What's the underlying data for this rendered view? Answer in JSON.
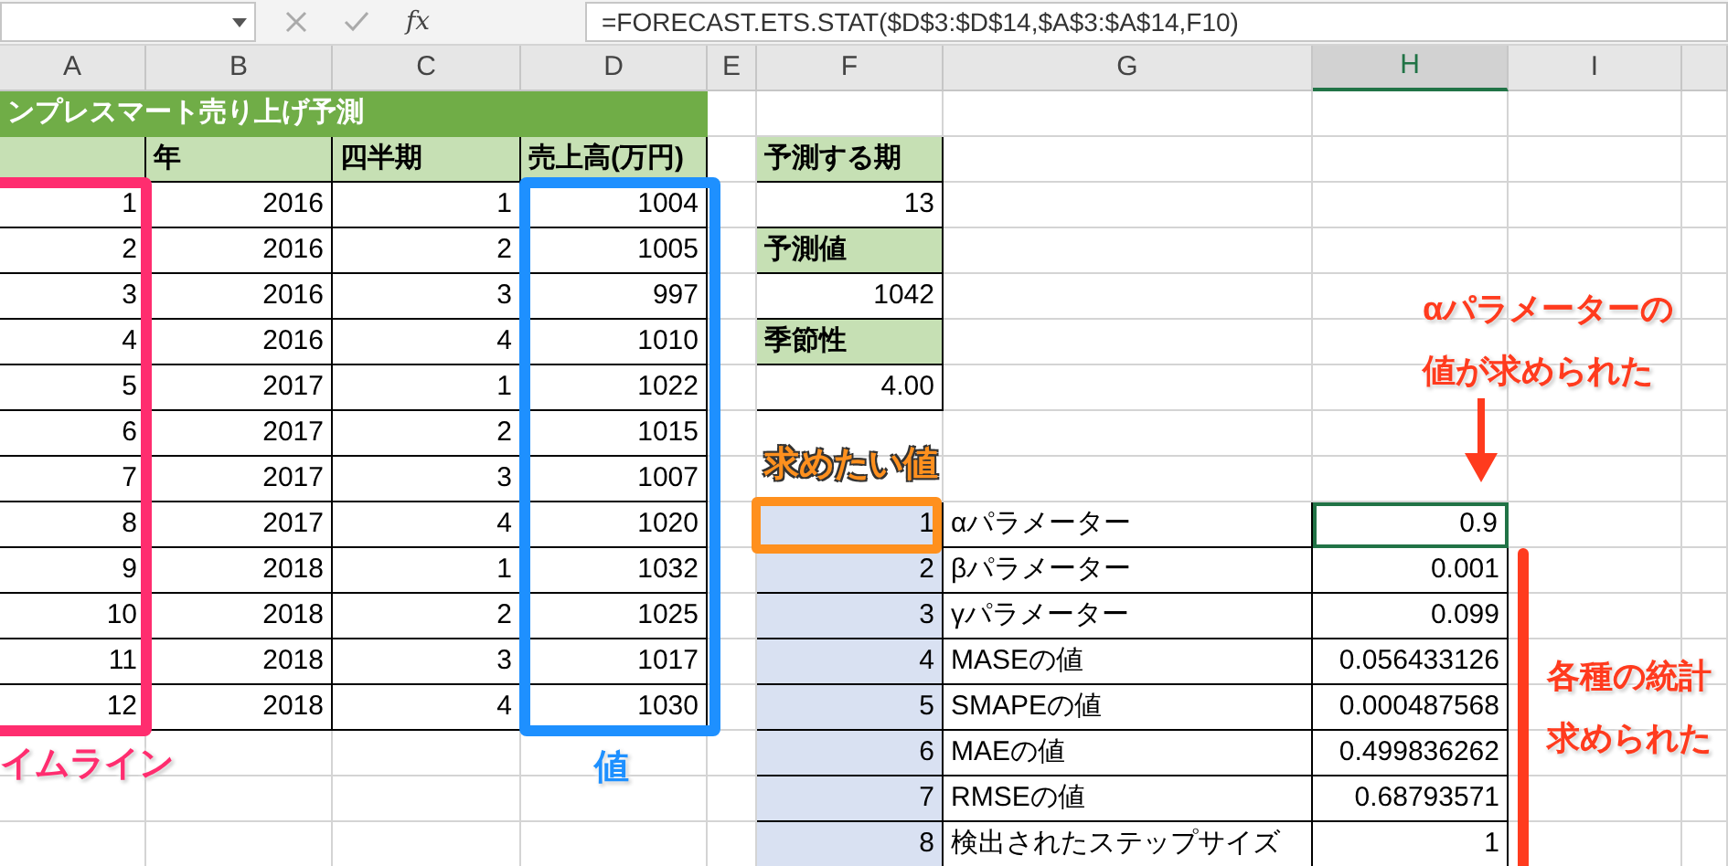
{
  "formula_bar": {
    "fx": "fx",
    "formula": "=FORECAST.ETS.STAT($D$3:$D$14,$A$3:$A$14,F10)"
  },
  "column_headers": [
    {
      "label": "A",
      "selected": false
    },
    {
      "label": "B",
      "selected": false
    },
    {
      "label": "C",
      "selected": false
    },
    {
      "label": "D",
      "selected": false
    },
    {
      "label": "E",
      "selected": false
    },
    {
      "label": "F",
      "selected": false
    },
    {
      "label": "G",
      "selected": false
    },
    {
      "label": "H",
      "selected": true
    },
    {
      "label": "I",
      "selected": false
    }
  ],
  "sheet_title": "ンプレスマート売り上げ予測",
  "sales_table": {
    "columns": [
      "",
      "年",
      "四半期",
      "売上高(万円)"
    ],
    "rows": [
      [
        "1",
        "2016",
        "1",
        "1004"
      ],
      [
        "2",
        "2016",
        "2",
        "1005"
      ],
      [
        "3",
        "2016",
        "3",
        "997"
      ],
      [
        "4",
        "2016",
        "4",
        "1010"
      ],
      [
        "5",
        "2017",
        "1",
        "1022"
      ],
      [
        "6",
        "2017",
        "2",
        "1015"
      ],
      [
        "7",
        "2017",
        "3",
        "1007"
      ],
      [
        "8",
        "2017",
        "4",
        "1020"
      ],
      [
        "9",
        "2018",
        "1",
        "1032"
      ],
      [
        "10",
        "2018",
        "2",
        "1025"
      ],
      [
        "11",
        "2018",
        "3",
        "1017"
      ],
      [
        "12",
        "2018",
        "4",
        "1030"
      ]
    ]
  },
  "forecast_box": [
    {
      "label": "予測する期",
      "value": "13"
    },
    {
      "label": "予測値",
      "value": "1042"
    },
    {
      "label": "季節性",
      "value": "4.00"
    }
  ],
  "stats_table": [
    {
      "index": "1",
      "label": "αパラメーター",
      "value": "0.9",
      "selected": true
    },
    {
      "index": "2",
      "label": "βパラメーター",
      "value": "0.001",
      "selected": false
    },
    {
      "index": "3",
      "label": "γパラメーター",
      "value": "0.099",
      "selected": false
    },
    {
      "index": "4",
      "label": "MASEの値",
      "value": "0.056433126",
      "selected": false
    },
    {
      "index": "5",
      "label": "SMAPEの値",
      "value": "0.000487568",
      "selected": false
    },
    {
      "index": "6",
      "label": "MAEの値",
      "value": "0.499836262",
      "selected": false
    },
    {
      "index": "7",
      "label": "RMSEの値",
      "value": "0.68793571",
      "selected": false
    },
    {
      "index": "8",
      "label": "検出されたステップサイズ",
      "value": "1",
      "selected": false
    }
  ],
  "annotations": {
    "timeline_label": "イムライン",
    "value_label": "値",
    "target_label": "求めたい値",
    "alpha_note": [
      "αパラメーターの",
      "値が求められた"
    ],
    "stats_note": [
      "各種の統計",
      "求められた"
    ]
  }
}
